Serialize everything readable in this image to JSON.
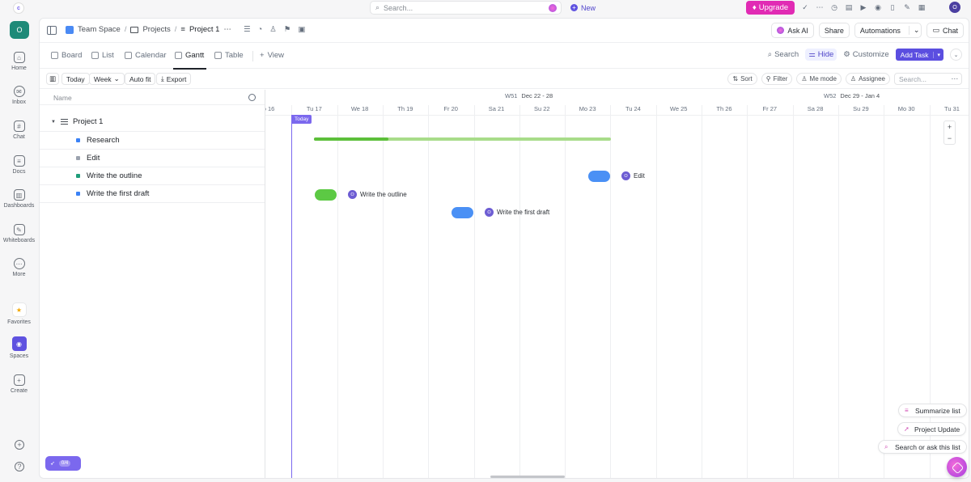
{
  "topbar": {
    "search_placeholder": "Search...",
    "new_label": "New",
    "upgrade_label": "Upgrade",
    "user_initial": "O",
    "logo_glyph": "c"
  },
  "rail": {
    "workspace_initial": "O",
    "items": [
      {
        "label": "Home",
        "icon": "home-icon",
        "glyph": "⌂"
      },
      {
        "label": "Inbox",
        "icon": "inbox-icon",
        "glyph": "✉"
      },
      {
        "label": "Chat",
        "icon": "chat-icon",
        "glyph": "#"
      },
      {
        "label": "Docs",
        "icon": "docs-icon",
        "glyph": "≡"
      },
      {
        "label": "Dashboards",
        "icon": "dashboards-icon",
        "glyph": "▥"
      },
      {
        "label": "Whiteboards",
        "icon": "whiteboards-icon",
        "glyph": "✎"
      },
      {
        "label": "More",
        "icon": "more-icon",
        "glyph": "⋯"
      },
      {
        "label": "Favorites",
        "icon": "star-icon",
        "glyph": "★"
      },
      {
        "label": "Spaces",
        "icon": "spaces-icon",
        "glyph": "◉"
      },
      {
        "label": "Create",
        "icon": "create-icon",
        "glyph": "+"
      }
    ],
    "rocket_count": "0/4"
  },
  "header": {
    "breadcrumb": [
      "Team Space",
      "Projects",
      "Project 1"
    ],
    "more_glyph": "⋯",
    "ask_ai": "Ask AI",
    "share": "Share",
    "automations": "Automations",
    "chat": "Chat"
  },
  "views": {
    "tabs": [
      {
        "label": "Board",
        "active": false
      },
      {
        "label": "List",
        "active": false
      },
      {
        "label": "Calendar",
        "active": false
      },
      {
        "label": "Gantt",
        "active": true
      },
      {
        "label": "Table",
        "active": false
      }
    ],
    "add_view": "View",
    "search": "Search",
    "hide": "Hide",
    "customize": "Customize",
    "add_task": "Add Task"
  },
  "toolbar": {
    "today": "Today",
    "week": "Week",
    "autofit": "Auto fit",
    "export": "Export",
    "sort": "Sort",
    "filter": "Filter",
    "me_mode": "Me mode",
    "assignee": "Assignee",
    "search_placeholder": "Search..."
  },
  "list": {
    "name_header": "Name",
    "project": "Project 1",
    "tasks": [
      {
        "name": "Research",
        "color": "#3b82f6"
      },
      {
        "name": "Edit",
        "color": "#9ca3af"
      },
      {
        "name": "Write the outline",
        "color": "#1f9d7a"
      },
      {
        "name": "Write the first draft",
        "color": "#3b82f6"
      }
    ]
  },
  "gantt": {
    "weeks": [
      {
        "code": "W51",
        "range": "Dec 22 - 28"
      },
      {
        "code": "W52",
        "range": "Dec 29 - Jan 4"
      }
    ],
    "days": [
      "o 16",
      "Tu 17",
      "We 18",
      "Th 19",
      "Fr 20",
      "Sa 21",
      "Su 22",
      "Mo 23",
      "Tu 24",
      "We 25",
      "Th 26",
      "Fr 27",
      "Sa 28",
      "Su 29",
      "Mo 30",
      "Tu 31"
    ],
    "today_label": "Today",
    "project_progress": 0.25,
    "bars": [
      {
        "task": "Edit",
        "color": "#4a90f5",
        "assignee": "O",
        "label": "Edit"
      },
      {
        "task": "Write the outline",
        "color": "#5cc944",
        "assignee": "O",
        "label": "Write the outline"
      },
      {
        "task": "Write the first draft",
        "color": "#4a90f5",
        "assignee": "O",
        "label": "Write the first draft"
      }
    ]
  },
  "floating": {
    "summarize": "Summarize list",
    "project_update": "Project Update",
    "search_ask": "Search or ask this list"
  }
}
